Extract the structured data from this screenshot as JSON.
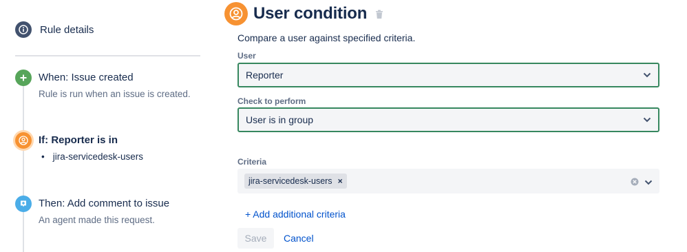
{
  "sidebar": {
    "rule_details_label": "Rule details",
    "steps": [
      {
        "title": "When: Issue created",
        "description": "Rule is run when an issue is created.",
        "icon": "plus-icon",
        "color": "#57a55a"
      },
      {
        "title": "If: Reporter is in",
        "bullet": "jira-servicedesk-users",
        "icon": "user-icon",
        "color": "#f79232"
      },
      {
        "title": "Then: Add comment to issue",
        "description": "An agent made this request.",
        "icon": "comment-icon",
        "color": "#4bade8"
      }
    ]
  },
  "condition": {
    "title": "User condition",
    "subtitle": "Compare a user against specified criteria.",
    "user_label": "User",
    "user_value": "Reporter",
    "check_label": "Check to perform",
    "check_value": "User is in group",
    "criteria_label": "Criteria",
    "criteria_tag": "jira-servicedesk-users",
    "criteria_tag_remove": "×",
    "add_criteria": "+ Add additional criteria",
    "save_label": "Save",
    "cancel_label": "Cancel"
  },
  "colors": {
    "accent_orange": "#f79232",
    "select_border": "#36875e",
    "link_blue": "#0052cc"
  }
}
